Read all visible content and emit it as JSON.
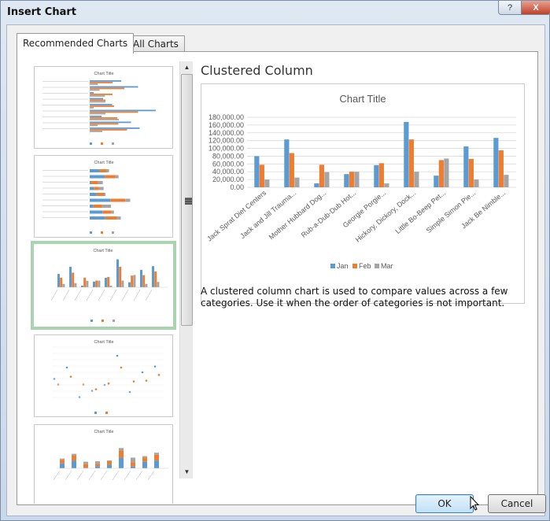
{
  "window": {
    "title": "Insert Chart",
    "help_label": "?",
    "close_label": "X"
  },
  "tabs": [
    {
      "label": "Recommended Charts",
      "active": true
    },
    {
      "label": "All Charts",
      "active": false
    }
  ],
  "thumbnails": [
    {
      "title": "Chart Title",
      "type": "clustered-bar"
    },
    {
      "title": "Chart Title",
      "type": "stacked-bar"
    },
    {
      "title": "Chart Title",
      "type": "clustered-column",
      "selected": true
    },
    {
      "title": "Chart Title",
      "type": "scatter"
    },
    {
      "title": "Chart Title",
      "type": "stacked-column"
    }
  ],
  "preview": {
    "heading": "Clustered Column",
    "description": "A clustered column chart is used to compare values across a few categories. Use it when the order of categories is not important."
  },
  "chart_data": {
    "type": "bar",
    "title": "Chart Title",
    "categories": [
      "Jack Sprat Diet Centers",
      "Jack and Jill Trauma...",
      "Mother Hubbard Dog...",
      "Rub-a-Dub-Dub Hot...",
      "Georgie Porgie...",
      "Hickory, Dickory, Dock...",
      "Little Bo-Beep Pet...",
      "Simple Simon Pie...",
      "Jack Be Nimble..."
    ],
    "series": [
      {
        "name": "Jan",
        "color": "#5b9bd5",
        "values": [
          80000,
          123000,
          10000,
          34000,
          57000,
          168000,
          30000,
          105000,
          127000
        ]
      },
      {
        "name": "Feb",
        "color": "#ed7d31",
        "values": [
          58000,
          88000,
          58000,
          40000,
          62000,
          123000,
          70000,
          73000,
          95000
        ]
      },
      {
        "name": "Mar",
        "color": "#a5a5a5",
        "values": [
          20000,
          25000,
          39000,
          40000,
          10000,
          40000,
          74000,
          20000,
          32000
        ]
      }
    ],
    "yticks": [
      "0.00",
      "20,000.00",
      "40,000.00",
      "60,000.00",
      "80,000.00",
      "100,000.00",
      "120,000.00",
      "140,000.00",
      "160,000.00",
      "180,000.00"
    ],
    "ylim": [
      0,
      180000
    ],
    "legend_position": "bottom",
    "grid": true
  },
  "buttons": {
    "ok": "OK",
    "cancel": "Cancel"
  }
}
